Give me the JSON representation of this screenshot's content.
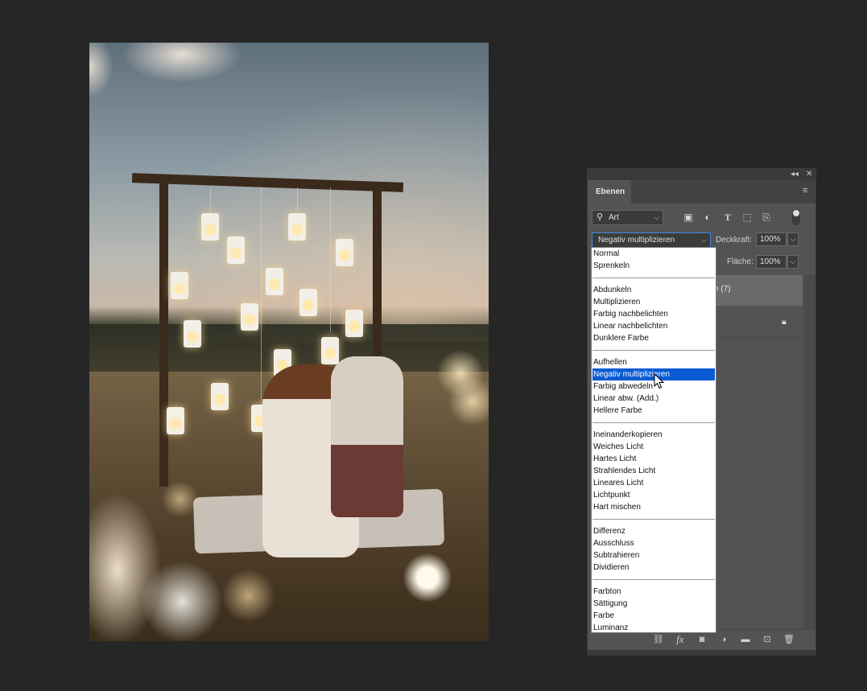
{
  "panel": {
    "tab_label": "Ebenen",
    "filter": {
      "value": "Art",
      "icons": [
        "image-icon",
        "adjustment-icon",
        "type-icon",
        "shape-icon",
        "smart-object-icon"
      ]
    },
    "blend_mode": {
      "value": "Negativ multiplizieren"
    },
    "opacity": {
      "label": "Deckkraft:",
      "value": "100%"
    },
    "fill": {
      "label": "Fläche:",
      "value": "100%"
    },
    "layers": [
      {
        "label": "e (7)"
      }
    ],
    "bottom_icons": [
      "link-icon",
      "fx-icon",
      "mask-icon",
      "adjustment-layer-icon",
      "group-folder-icon",
      "new-layer-icon",
      "trash-icon"
    ]
  },
  "blend_list": {
    "groups": [
      [
        "Normal",
        "Sprenkeln"
      ],
      [
        "Abdunkeln",
        "Multiplizieren",
        "Farbig nachbelichten",
        "Linear nachbelichten",
        "Dunklere Farbe"
      ],
      [
        "Aufhellen",
        "Negativ multiplizieren",
        "Farbig abwedeln",
        "Linear abw. (Add.)",
        "Hellere Farbe"
      ],
      [
        "Ineinanderkopieren",
        "Weiches Licht",
        "Hartes Licht",
        "Strahlendes Licht",
        "Lineares Licht",
        "Lichtpunkt",
        "Hart mischen"
      ],
      [
        "Differenz",
        "Ausschluss",
        "Subtrahieren",
        "Dividieren"
      ],
      [
        "Farbton",
        "Sättigung",
        "Farbe",
        "Luminanz"
      ]
    ],
    "selected": "Negativ multiplizieren"
  }
}
